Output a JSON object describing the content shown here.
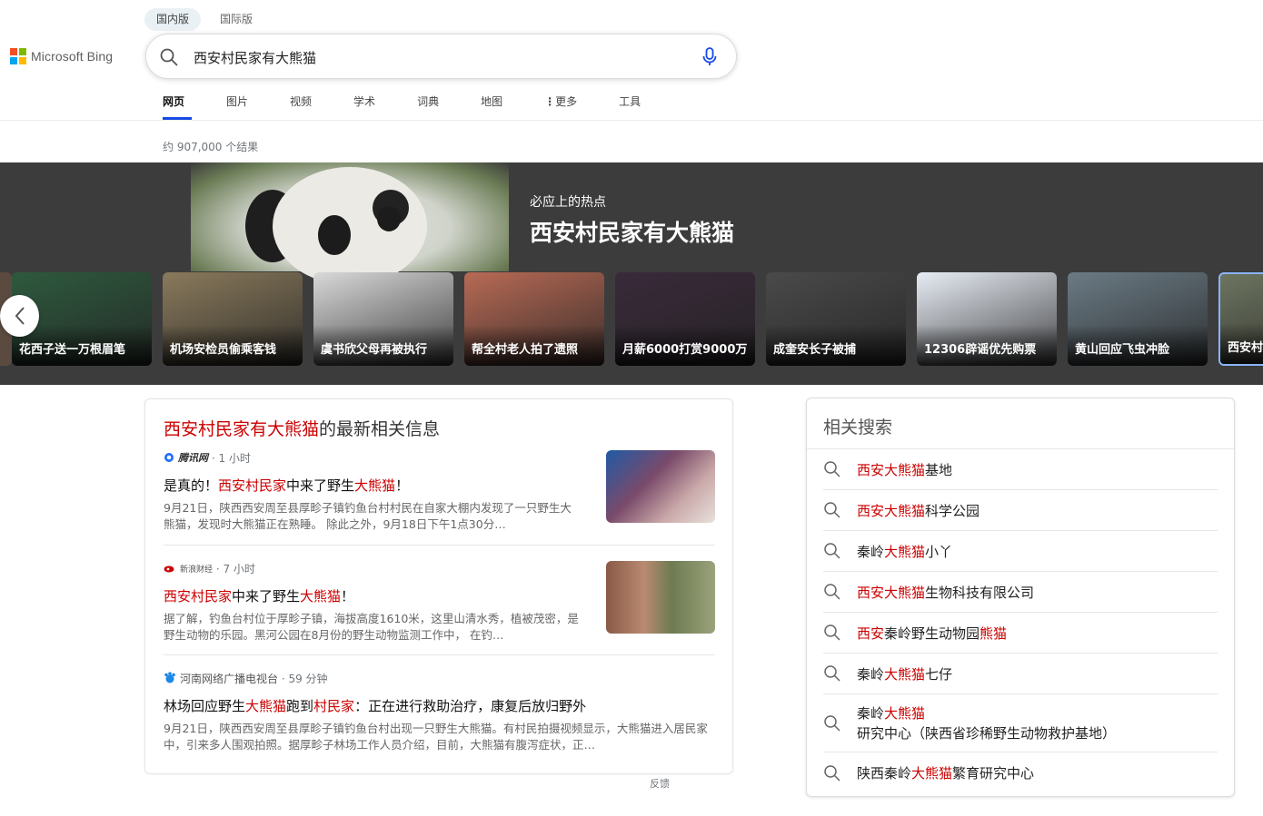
{
  "logo": {
    "text": "Microsoft Bing",
    "colors": [
      "#f25022",
      "#7fba00",
      "#00a4ef",
      "#ffb900"
    ]
  },
  "region_tabs": [
    {
      "label": "国内版",
      "active": true
    },
    {
      "label": "国际版",
      "active": false
    }
  ],
  "search": {
    "query": "西安村民家有大熊猫"
  },
  "nav": [
    {
      "label": "网页",
      "active": true
    },
    {
      "label": "图片"
    },
    {
      "label": "视频"
    },
    {
      "label": "学术"
    },
    {
      "label": "词典"
    },
    {
      "label": "地图"
    },
    {
      "label": "更多",
      "icon": "more-vertical-icon"
    },
    {
      "label": "工具"
    }
  ],
  "results_count": "约 907,000 个结果",
  "hot": {
    "subtitle": "必应上的热点",
    "title": "西安村民家有大熊猫",
    "cards": [
      {
        "label": "花西子送一万根眉笔",
        "color": "#2e5a3e"
      },
      {
        "label": "机场安检员偷乘客钱",
        "color": "#8a7a5c"
      },
      {
        "label": "虞书欣父母再被执行",
        "color": "#d9d9d9"
      },
      {
        "label": "帮全村老人拍了遗照",
        "color": "#b86a55"
      },
      {
        "label": "月薪6000打赏9000万",
        "color": "#3a2a3a"
      },
      {
        "label": "成奎安长子被捕",
        "color": "#4a4a4a"
      },
      {
        "label": "12306辟谣优先购票",
        "color": "#e8edf5"
      },
      {
        "label": "黄山回应飞虫冲脸",
        "color": "#6b7b85"
      },
      {
        "label": "西安村民",
        "color": "#6d7560"
      }
    ]
  },
  "news": {
    "heading_hl": "西安村民家有大熊猫",
    "heading_rest": "的最新相关信息",
    "stories": [
      {
        "source": "腾讯网",
        "time": "· 1 小时",
        "title_parts": [
          "是真的！",
          "西安村民家",
          "中来了野生",
          "大熊猫",
          "！"
        ],
        "snippet": "9月21日，陕西西安周至县厚畛子镇钓鱼台村村民在自家大棚内发现了一只野生大熊猫，发现时大熊猫正在熟睡。 除此之外，9月18日下午1点30分…"
      },
      {
        "source": "新浪财经",
        "time": "· 7 小时",
        "title_parts": [
          "",
          "西安村民家",
          "中来了野生",
          "大熊猫",
          "！"
        ],
        "snippet": "据了解，钓鱼台村位于厚畛子镇，海拔高度1610米，这里山清水秀，植被茂密，是野生动物的乐园。黑河公园在8月份的野生动物监测工作中， 在钓…"
      },
      {
        "source": "河南网络广播电视台",
        "time": "· 59 分钟",
        "title_parts": [
          "林场回应野生",
          "大熊猫",
          "跑到",
          "村民家",
          "：正在进行救助治疗，康复后放归野外"
        ],
        "snippet": "9月21日，陕西西安周至县厚畛子镇钓鱼台村出现一只野生大熊猫。有村民拍摄视频显示，大熊猫进入居民家中，引来多人围观拍照。据厚畛子林场工作人员介绍，目前，大熊猫有腹泻症状，正…"
      }
    ],
    "feedback": "反馈"
  },
  "related": {
    "heading": "相关搜索",
    "items": [
      {
        "parts": [
          "西安大熊猫",
          "基地"
        ]
      },
      {
        "parts": [
          "西安大熊猫",
          "科学公园"
        ]
      },
      {
        "parts": [
          "秦岭",
          "大熊猫",
          "小丫"
        ]
      },
      {
        "parts": [
          "西安大熊猫",
          "生物科技有限公司"
        ]
      },
      {
        "parts": [
          "西安",
          "秦岭野生动物园",
          "熊猫"
        ]
      },
      {
        "parts": [
          "秦岭",
          "大熊猫",
          "七仔"
        ]
      },
      {
        "parts": [
          "秦岭",
          "大熊猫",
          "研究中心（陕西省珍稀野生动物救护基地）"
        ]
      },
      {
        "parts": [
          "陕西秦岭",
          "大熊猫",
          "繁育研究中心"
        ]
      }
    ]
  }
}
